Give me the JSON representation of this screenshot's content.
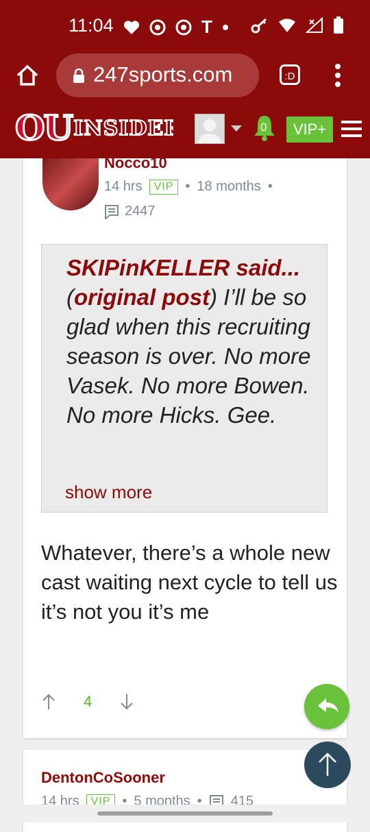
{
  "status_bar": {
    "time": "11:04",
    "carrier_letter": "T"
  },
  "browser": {
    "url": "247sports.com",
    "tabs_label": ":D"
  },
  "site": {
    "logo_ou": "OU",
    "logo_inside": "INSIDER",
    "notifications": "0",
    "vip_label": "VIP+"
  },
  "post": {
    "username": "Nocco10",
    "time_ago": "14 hrs",
    "badge": "VIP",
    "membership": "18 months",
    "post_count": "2447",
    "quote": {
      "author": "SKIPinKELLER said...",
      "open_paren": "(",
      "original_link": "original post",
      "text": ") I’ll be so glad when this recruiting season is over. No more Vasek. No more Bowen. No more Hicks. Gee.",
      "show_more": "show more"
    },
    "body": "Whatever, there’s a whole new cast waiting next cycle to tell us it’s not you it’s me",
    "vote_count": "4"
  },
  "post2": {
    "username": "DentonCoSooner",
    "time_ago": "14 hrs",
    "badge": "VIP",
    "membership": "5 months",
    "post_count": "415"
  },
  "colors": {
    "brand": "#8b0a0a",
    "green": "#6ac13a",
    "fab_top": "#2b4a5e"
  }
}
